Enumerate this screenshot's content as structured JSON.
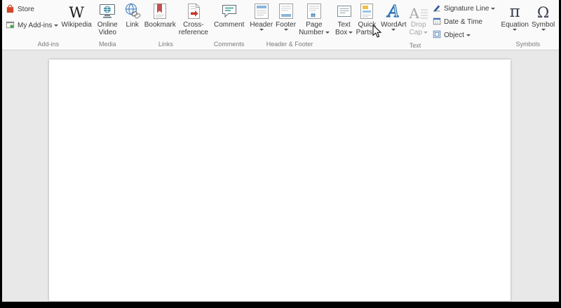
{
  "ribbon": {
    "groups": {
      "addins": {
        "label": "Add-ins",
        "store": "Store",
        "my_addins": "My Add-ins",
        "wikipedia": "Wikipedia"
      },
      "media": {
        "label": "Media",
        "online_video": [
          "Online",
          "Video"
        ]
      },
      "links": {
        "label": "Links",
        "link": "Link",
        "bookmark": "Bookmark",
        "cross_reference": [
          "Cross-",
          "reference"
        ]
      },
      "comments": {
        "label": "Comments",
        "comment": "Comment"
      },
      "header_footer": {
        "label": "Header & Footer",
        "header": "Header",
        "footer": "Footer",
        "page_number": [
          "Page",
          "Number"
        ]
      },
      "text": {
        "label": "Text",
        "text_box": [
          "Text",
          "Box"
        ],
        "quick_parts": [
          "Quick",
          "Parts"
        ],
        "wordart": "WordArt",
        "drop_cap": [
          "Drop",
          "Cap"
        ],
        "signature_line": "Signature Line",
        "date_time": "Date & Time",
        "object": "Object"
      },
      "symbols": {
        "label": "Symbols",
        "equation": "Equation",
        "symbol": "Symbol"
      }
    }
  },
  "icons": {
    "wikipedia_glyph": "W",
    "wordart_glyph": "A",
    "drop_cap_glyph": "A",
    "equation_glyph": "π",
    "symbol_glyph": "Ω"
  },
  "colors": {
    "ribbon_bg": "#fafafa",
    "doc_bg": "#e8e8e8",
    "page_bg": "#ffffff",
    "accent_blue": "#2b579a",
    "store_orange": "#d24726"
  }
}
